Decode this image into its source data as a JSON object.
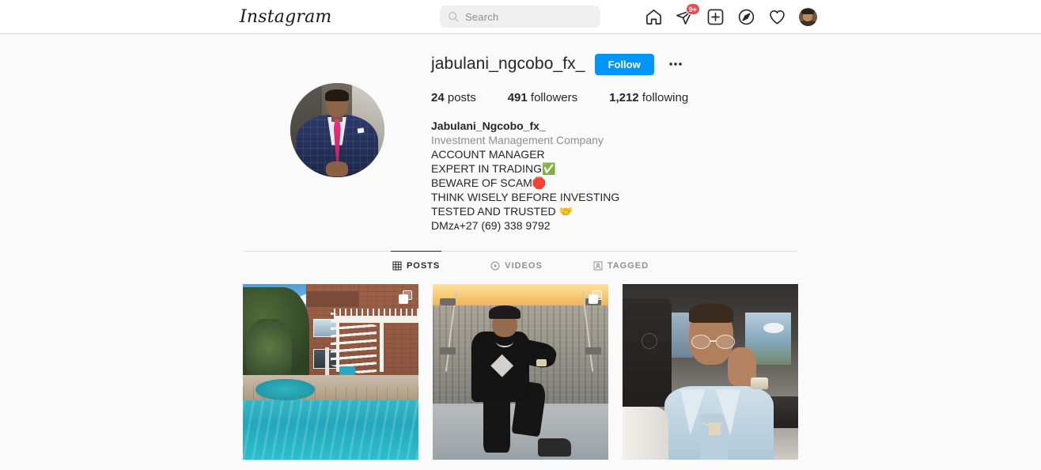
{
  "navbar": {
    "logo_text": "Instagram",
    "search": {
      "placeholder": "Search",
      "value": "",
      "icon": "search-icon"
    },
    "icons": [
      {
        "name": "home-icon",
        "label": "Home"
      },
      {
        "name": "direct-messages-icon",
        "label": "Messages",
        "badge": "9+"
      },
      {
        "name": "new-post-icon",
        "label": "New post"
      },
      {
        "name": "explore-icon",
        "label": "Explore"
      },
      {
        "name": "activity-heart-icon",
        "label": "Activity"
      },
      {
        "name": "profile-avatar",
        "label": "Profile"
      }
    ],
    "badge_color": "#ed4956"
  },
  "profile": {
    "avatar_alt": "Man in navy plaid suit with pink tie",
    "username": "jabulani_ngcobo_fx_",
    "follow_label": "Follow",
    "follow_color": "#0095f6",
    "options_label": "More options",
    "stats": [
      {
        "value": "24",
        "label": "posts"
      },
      {
        "value": "491",
        "label": "followers"
      },
      {
        "value": "1,212",
        "label": "following"
      }
    ],
    "bio": {
      "full_name": "Jabulani_Ngcobo_fx_",
      "category": "Investment Management Company",
      "lines": [
        "ACCOUNT MANAGER",
        "EXPERT IN TRADING✅",
        "BEWARE OF SCAM🛑",
        "THINK WISELY BEFORE INVESTING",
        "TESTED AND TRUSTED 🤝",
        "DMᴢᴀ+27 (69) 338 9792"
      ]
    }
  },
  "tabs": [
    {
      "id": "posts",
      "label": "POSTS",
      "icon": "grid-icon",
      "active": true
    },
    {
      "id": "videos",
      "label": "VIDEOS",
      "icon": "play-circle-icon",
      "active": false
    },
    {
      "id": "tagged",
      "label": "TAGGED",
      "icon": "tagged-person-icon",
      "active": false
    }
  ],
  "posts": [
    {
      "id": "post-1",
      "alt": "Backyard swimming pool with brick house and white deck stairs",
      "carousel": true
    },
    {
      "id": "post-2",
      "alt": "Man in black outfit and cap sitting on glass skydeck above city at sunset",
      "carousel": true
    },
    {
      "id": "post-3",
      "alt": "Man in light blue shirt with glasses sitting in a car",
      "carousel": false
    }
  ]
}
